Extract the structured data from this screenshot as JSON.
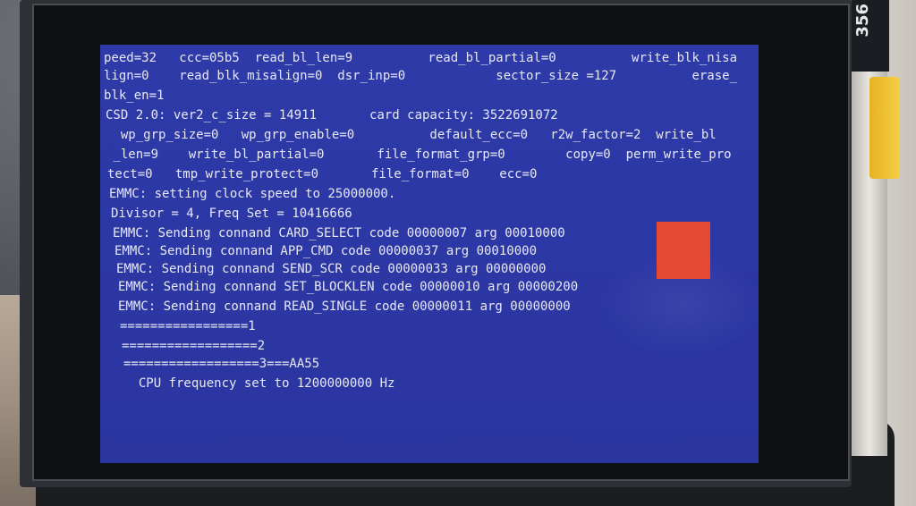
{
  "pcb": {
    "label": "356"
  },
  "console": {
    "lines": [
      "peed=32   ccc=05b5  read_bl_len=9          read_bl_partial=0          write_blk_nisa",
      "lign=0    read_blk_misalign=0  dsr_inp=0            sector_size =127          erase_",
      "blk_en=1",
      "CSD 2.0: ver2_c_size = 14911       card capacity: 3522691072",
      "  wp_grp_size=0   wp_grp_enable=0          default_ecc=0   r2w_factor=2  write_bl",
      " _len=9    write_bl_partial=0       file_format_grp=0        copy=0  perm_write_pro",
      "tect=0   tmp_write_protect=0       file_format=0    ecc=0",
      "EMMC: setting clock speed to 25000000.",
      "Divisor = 4, Freq Set = 10416666",
      "EMMC: Sending connand CARD_SELECT code 00000007 arg 00010000",
      "EMMC: Sending connand APP_CMD code 00000037 arg 00010000",
      "EMMC: Sending connand SEND_SCR code 00000033 arg 00000000",
      "EMMC: Sending connand SET_BLOCKLEN code 00000010 arg 00000200",
      "EMMC: Sending connand READ_SINGLE code 00000011 arg 00000000",
      "=================1",
      "==================2",
      "==================3===AA55",
      "  CPU frequency set to 1200000000 Hz"
    ]
  },
  "colors": {
    "screen": "#2c37a4",
    "text": "#e8e8f2",
    "square": "#e44a33"
  }
}
